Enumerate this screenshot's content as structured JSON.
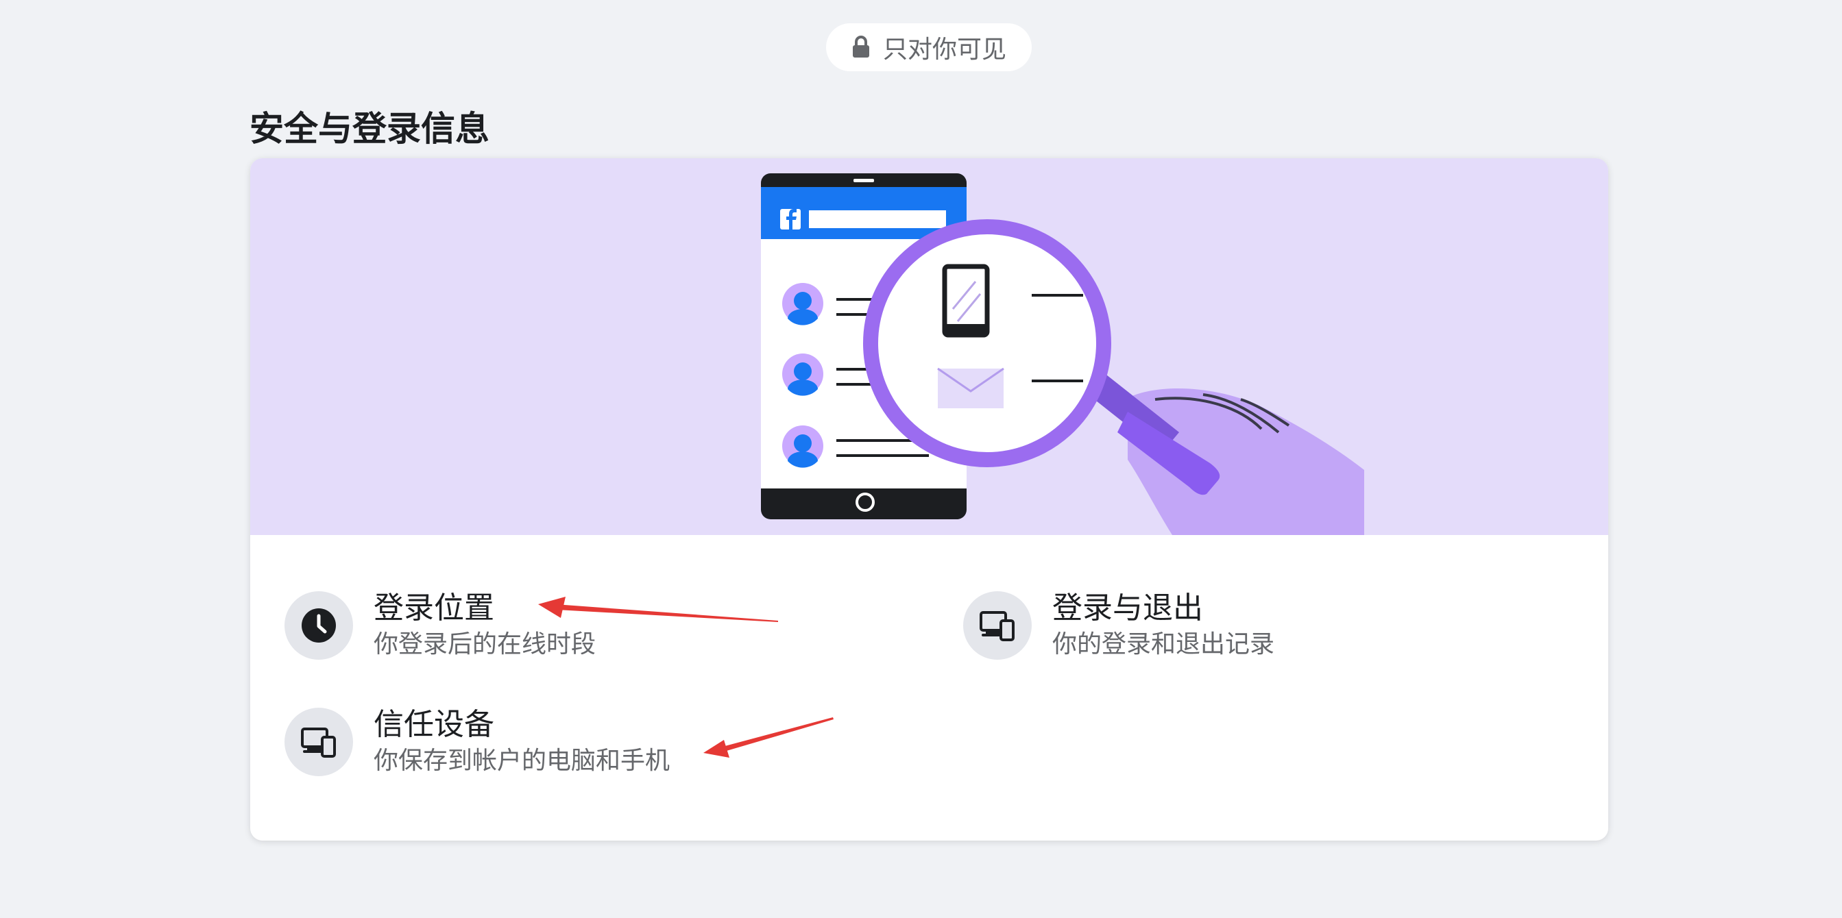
{
  "visibility": {
    "label": "只对你可见",
    "icon": "lock-icon"
  },
  "section": {
    "title": "安全与登录信息"
  },
  "banner": {
    "illustration": "phone-magnifier-hand-illustration",
    "brand_icon": "facebook-icon"
  },
  "options": [
    {
      "title": "登录位置",
      "subtitle": "你登录后的在线时段",
      "icon": "clock-icon"
    },
    {
      "title": "登录与退出",
      "subtitle": "你的登录和退出记录",
      "icon": "devices-icon"
    },
    {
      "title": "信任设备",
      "subtitle": "你保存到帐户的电脑和手机",
      "icon": "devices-icon"
    }
  ],
  "annotations": {
    "arrow_color": "#e53935"
  },
  "colors": {
    "background": "#f0f2f5",
    "banner": "#e4dcfa",
    "accent_purple": "#9b6cf0",
    "facebook_blue": "#1877f2"
  }
}
